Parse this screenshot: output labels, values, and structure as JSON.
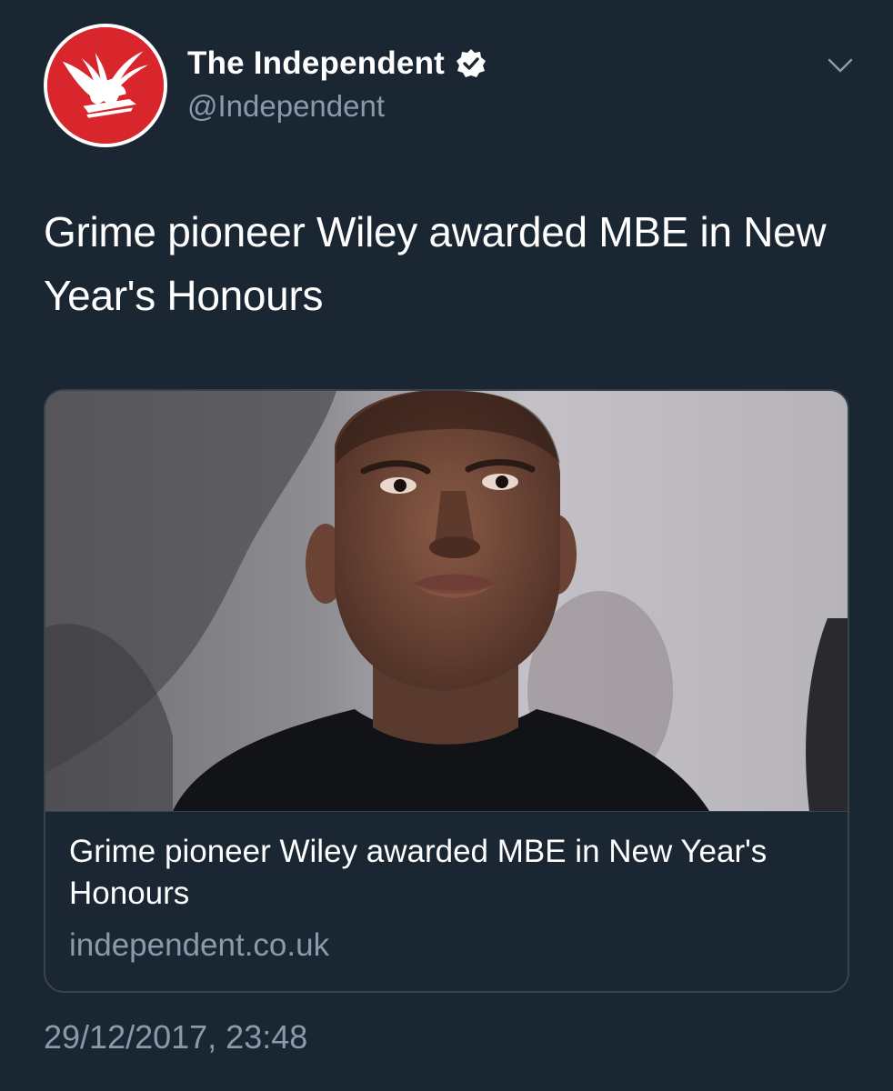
{
  "account": {
    "display_name": "The Independent",
    "handle": "@Independent",
    "verified": true,
    "avatar_icon": "eagle-logo-icon",
    "avatar_color": "#d9262c"
  },
  "tweet": {
    "text": "Grime pioneer Wiley awarded MBE in New Year's Honours",
    "timestamp": "29/12/2017, 23:48"
  },
  "card": {
    "image_icon": "portrait-photo",
    "title": "Grime pioneer Wiley awarded MBE in New Year's Honours",
    "domain": "independent.co.uk"
  },
  "icons": {
    "verified": "verified-badge-icon",
    "menu": "chevron-down-icon"
  },
  "colors": {
    "background": "#1b2633",
    "secondary_text": "#8a9aab",
    "border": "#38444d"
  }
}
